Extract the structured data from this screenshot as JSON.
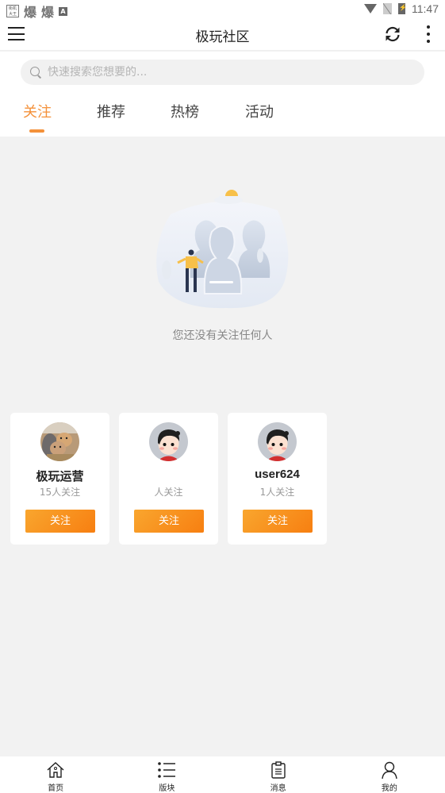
{
  "status_bar": {
    "app_icons": [
      "街机大王",
      "爆",
      "爆",
      "A"
    ],
    "time": "11:47"
  },
  "app_bar": {
    "title": "极玩社区",
    "menu_icon": "hamburger-menu-icon",
    "refresh_icon": "refresh-icon",
    "more_icon": "more-vertical-icon"
  },
  "search": {
    "placeholder": "快速搜索您想要的..."
  },
  "tabs": [
    {
      "label": "关注",
      "active": true
    },
    {
      "label": "推荐",
      "active": false
    },
    {
      "label": "热榜",
      "active": false
    },
    {
      "label": "活动",
      "active": false
    }
  ],
  "empty_state": {
    "illustration": "empty-follow-illustration",
    "message": "您还没有关注任何人"
  },
  "recommended_users": [
    {
      "name": "极玩运营",
      "followers": "15人关注",
      "avatar": "cats-photo",
      "button": "关注"
    },
    {
      "name": "",
      "followers": "人关注",
      "avatar": "cartoon-girl",
      "button": "关注"
    },
    {
      "name": "user624",
      "followers": "1人关注",
      "avatar": "cartoon-girl",
      "button": "关注"
    }
  ],
  "bottom_nav": [
    {
      "label": "首页",
      "icon": "home-icon"
    },
    {
      "label": "版块",
      "icon": "list-icon"
    },
    {
      "label": "消息",
      "icon": "clipboard-icon"
    },
    {
      "label": "我的",
      "icon": "user-icon"
    }
  ],
  "colors": {
    "accent": "#f4913a",
    "button_gradient_start": "#f9a62e",
    "button_gradient_end": "#f77f11",
    "page_background": "#f2f2f2"
  }
}
